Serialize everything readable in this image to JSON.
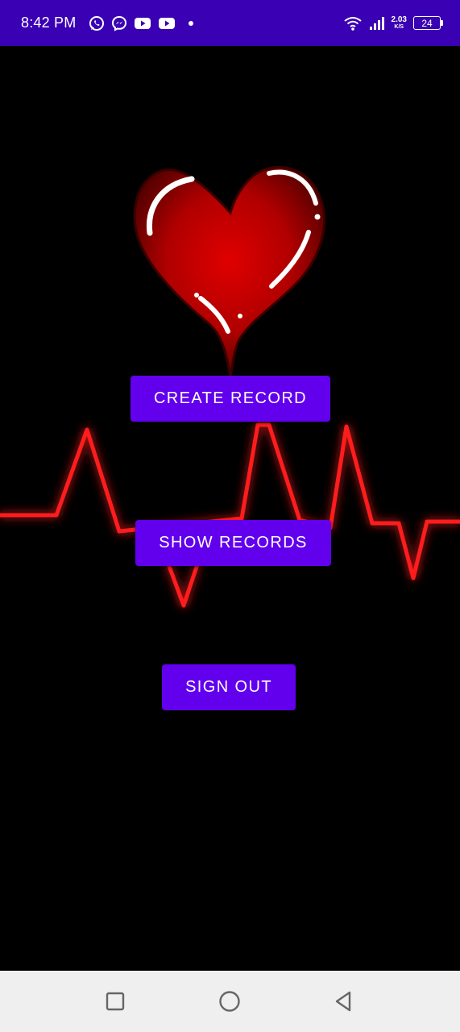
{
  "status_bar": {
    "time": "8:42 PM",
    "notification_icons": [
      "whatsapp-icon",
      "messenger-icon",
      "youtube-icon",
      "youtube-icon",
      "dot-icon"
    ],
    "net_speed_value": "2.03",
    "net_speed_unit": "K/S",
    "battery": "24",
    "background": "#3a00b3"
  },
  "main": {
    "background": "#000000",
    "create_record_label": "CREATE RECORD",
    "show_records_label": "SHOW RECORDS",
    "sign_out_label": "SIGN OUT",
    "button_color": "#6200ee"
  },
  "art": {
    "heart_color": "#c00000",
    "ecg_color": "#ff1a1a"
  },
  "nav_bar": {
    "icons": [
      "square-icon",
      "circle-icon",
      "triangle-back-icon"
    ],
    "background": "#efefef"
  }
}
